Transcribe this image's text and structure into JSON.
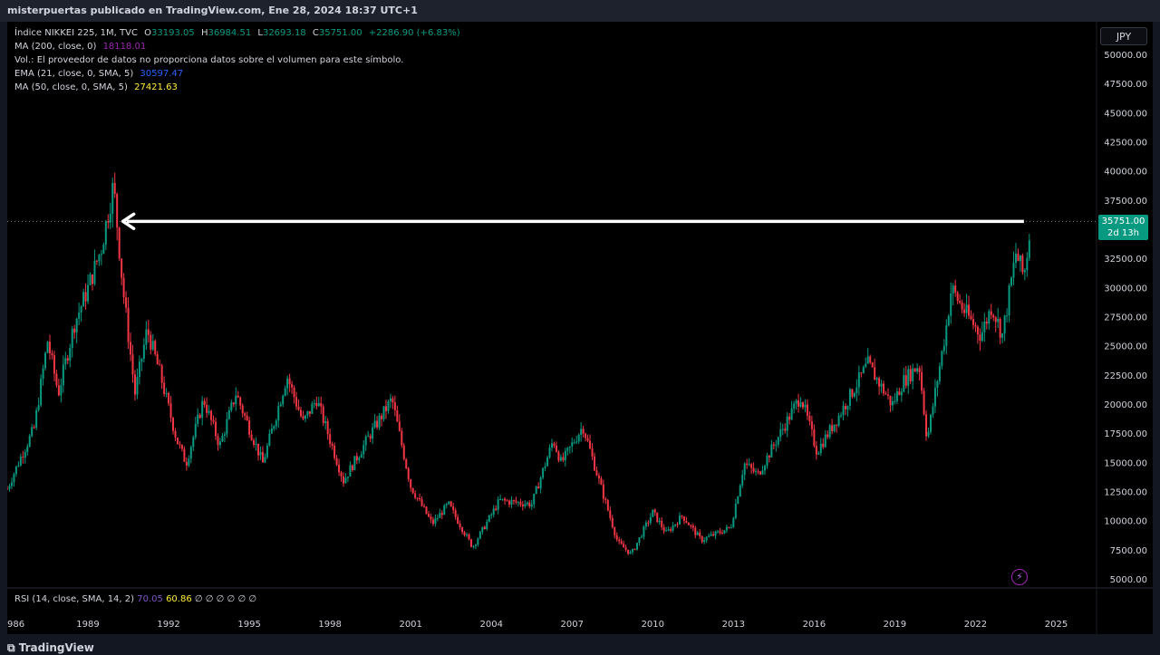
{
  "header": {
    "byline": "misterpuertas publicado en TradingView.com, Ene 28, 2024 18:37 UTC+1"
  },
  "legend": {
    "symbol": "Índice NIKKEI 225, 1M, TVC",
    "ohlc": {
      "o_label": "O",
      "o": "33193.05",
      "h_label": "H",
      "h": "36984.51",
      "l_label": "L",
      "l": "32693.18",
      "c_label": "C",
      "c": "35751.00",
      "change": "+2286.90 (+6.83%)"
    },
    "ma200_label": "MA (200, close, 0)",
    "ma200_value": "18118.01",
    "vol_note": "Vol.: El proveedor de datos no proporciona datos sobre el volumen para este símbolo.",
    "ema_label": "EMA (21, close, 0, SMA, 5)",
    "ema_value": "30597.47",
    "ma50_label": "MA (50, close, 0, SMA, 5)",
    "ma50_value": "27421.63"
  },
  "price_axis": {
    "currency": "JPY",
    "last_price": "35751.00",
    "countdown": "2d 13h"
  },
  "rsi": {
    "label": "RSI (14, close, SMA, 14, 2)",
    "value": "70.05",
    "ma_value": "60.86",
    "extras": "∅ ∅ ∅ ∅ ∅ ∅"
  },
  "footer": {
    "brand": "TradingView"
  },
  "colors": {
    "up": "#089981",
    "down": "#f23645",
    "background": "#000000",
    "ma200": "#9c27b0",
    "ema": "#2962ff",
    "ma50": "#ffeb3b",
    "arrow": "#ffffff"
  },
  "chart_data": {
    "type": "candlestick",
    "title": "Índice NIKKEI 225, 1M, TVC",
    "xlabel": "",
    "ylabel": "",
    "y_ticks": [
      5000,
      7500,
      10000,
      12500,
      15000,
      17500,
      20000,
      22500,
      25000,
      27500,
      30000,
      32500,
      35000,
      37500,
      40000,
      42500,
      45000,
      47500,
      50000
    ],
    "x_ticks": [
      "986",
      "1989",
      "1992",
      "1995",
      "1998",
      "2001",
      "2004",
      "2007",
      "2010",
      "2013",
      "2016",
      "2019",
      "2022",
      "2025"
    ],
    "ylim": [
      5000,
      50000
    ],
    "xlim": [
      1986.0,
      2026.5
    ],
    "price_path": [
      [
        1986.0,
        12800
      ],
      [
        1986.5,
        15500
      ],
      [
        1987.0,
        18000
      ],
      [
        1987.5,
        25500
      ],
      [
        1987.9,
        21000
      ],
      [
        1988.5,
        27000
      ],
      [
        1989.0,
        30000
      ],
      [
        1989.5,
        33500
      ],
      [
        1989.95,
        38900
      ],
      [
        1990.3,
        30000
      ],
      [
        1990.75,
        21000
      ],
      [
        1991.2,
        26500
      ],
      [
        1991.7,
        22500
      ],
      [
        1992.3,
        17000
      ],
      [
        1992.65,
        15000
      ],
      [
        1993.3,
        20500
      ],
      [
        1993.9,
        16500
      ],
      [
        1994.5,
        21000
      ],
      [
        1995.5,
        15000
      ],
      [
        1996.4,
        22500
      ],
      [
        1997.0,
        18500
      ],
      [
        1997.5,
        20500
      ],
      [
        1998.5,
        13500
      ],
      [
        1999.5,
        17500
      ],
      [
        2000.3,
        20500
      ],
      [
        2001.0,
        13000
      ],
      [
        2001.8,
        9800
      ],
      [
        2002.4,
        11500
      ],
      [
        2003.3,
        7800
      ],
      [
        2004.3,
        11800
      ],
      [
        2005.5,
        11500
      ],
      [
        2006.3,
        17000
      ],
      [
        2006.6,
        15000
      ],
      [
        2007.4,
        18200
      ],
      [
        2008.0,
        13500
      ],
      [
        2008.7,
        8200
      ],
      [
        2009.2,
        7200
      ],
      [
        2010.0,
        10800
      ],
      [
        2010.5,
        9000
      ],
      [
        2011.1,
        10500
      ],
      [
        2011.8,
        8400
      ],
      [
        2012.9,
        9500
      ],
      [
        2013.4,
        15000
      ],
      [
        2013.9,
        14000
      ],
      [
        2015.5,
        20800
      ],
      [
        2016.1,
        16000
      ],
      [
        2016.9,
        19000
      ],
      [
        2018.0,
        23500
      ],
      [
        2018.9,
        20000
      ],
      [
        2019.3,
        22000
      ],
      [
        2019.9,
        23500
      ],
      [
        2020.2,
        17000
      ],
      [
        2020.9,
        26500
      ],
      [
        2021.1,
        30000
      ],
      [
        2021.6,
        28000
      ],
      [
        2022.2,
        26000
      ],
      [
        2022.6,
        28500
      ],
      [
        2023.0,
        26000
      ],
      [
        2023.5,
        33000
      ],
      [
        2023.8,
        31000
      ],
      [
        2024.07,
        35751
      ]
    ],
    "last_close": 35751.0,
    "annotations": [
      {
        "type": "horizontal-arrow",
        "y": 35751,
        "x_start": 2023.8,
        "x_end": 1990.3,
        "direction": "left"
      }
    ],
    "indicators": [
      "MA (200, close, 0)",
      "EMA (21, close, 0, SMA, 5)",
      "MA (50, close, 0, SMA, 5)",
      "RSI (14, close, SMA, 14, 2)"
    ]
  }
}
